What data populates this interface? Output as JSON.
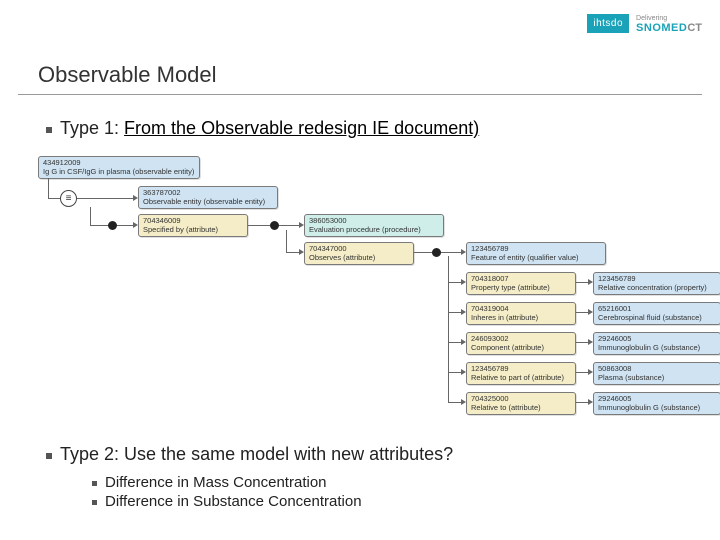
{
  "header": {
    "ihtsdo": "ihtsdo",
    "delivering": "Delivering",
    "snomed": "SNOMED",
    "ct": "CT"
  },
  "title": "Observable Model",
  "type1": {
    "prefix": "Type 1: ",
    "link": "From the Observable redesign IE document)"
  },
  "type2": "Type 2: Use the same model with new attributes?",
  "sub": {
    "a": "Difference in Mass Concentration",
    "b": "Difference in Substance Concentration"
  },
  "diagram": {
    "root": {
      "id": "434912009",
      "label": "Ig G in CSF/IgG in plasma (observable entity)"
    },
    "obs_ent": {
      "id": "363787002",
      "label": "Observable entity (observable entity)"
    },
    "spec_by": {
      "id": "704346009",
      "label": "Specified by (attribute)"
    },
    "eval_proc": {
      "id": "386053000",
      "label": "Evaluation procedure (procedure)"
    },
    "observes": {
      "id": "704347000",
      "label": "Observes (attribute)"
    },
    "feature": {
      "id": "123456789",
      "label": "Feature of entity (qualifier value)"
    },
    "prop_type": {
      "id": "704318007",
      "label": "Property type (attribute)"
    },
    "rel_conc": {
      "id": "123456789",
      "label": "Relative concentration (property)"
    },
    "inheres": {
      "id": "704319004",
      "label": "Inheres in (attribute)"
    },
    "csf": {
      "id": "65216001",
      "label": "Cerebrospinal fluid (substance)"
    },
    "component": {
      "id": "246093002",
      "label": "Component (attribute)"
    },
    "iggc": {
      "id": "29246005",
      "label": "Immunoglobulin G (substance)"
    },
    "rel_part": {
      "id": "123456789",
      "label": "Relative to part of (attribute)"
    },
    "plasma": {
      "id": "50863008",
      "label": "Plasma (substance)"
    },
    "rel_to": {
      "id": "704325000",
      "label": "Relative to (attribute)"
    },
    "iggr": {
      "id": "29246005",
      "label": "Immunoglobulin G (substance)"
    }
  }
}
